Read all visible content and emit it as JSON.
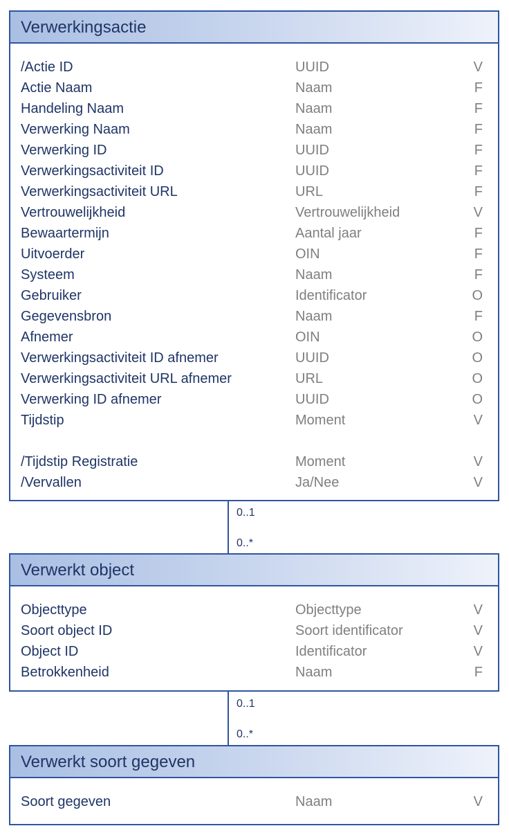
{
  "classes": [
    {
      "title": "Verwerkingsactie",
      "attributes": [
        {
          "name": "/Actie ID",
          "type": "UUID",
          "flag": "V"
        },
        {
          "name": "Actie Naam",
          "type": "Naam",
          "flag": "F"
        },
        {
          "name": "Handeling Naam",
          "type": "Naam",
          "flag": "F"
        },
        {
          "name": "Verwerking Naam",
          "type": "Naam",
          "flag": "F"
        },
        {
          "name": "Verwerking ID",
          "type": "UUID",
          "flag": "F"
        },
        {
          "name": "Verwerkingsactiviteit ID",
          "type": "UUID",
          "flag": "F"
        },
        {
          "name": "Verwerkingsactiviteit URL",
          "type": "URL",
          "flag": "F"
        },
        {
          "name": "Vertrouwelijkheid",
          "type": "Vertrouwelijkheid",
          "flag": "V"
        },
        {
          "name": "Bewaartermijn",
          "type": "Aantal jaar",
          "flag": "F"
        },
        {
          "name": "Uitvoerder",
          "type": "OIN",
          "flag": "F"
        },
        {
          "name": "Systeem",
          "type": "Naam",
          "flag": "F"
        },
        {
          "name": "Gebruiker",
          "type": "Identificator",
          "flag": "O"
        },
        {
          "name": "Gegevensbron",
          "type": "Naam",
          "flag": "F"
        },
        {
          "name": "Afnemer",
          "type": "OIN",
          "flag": "O"
        },
        {
          "name": "Verwerkingsactiviteit ID afnemer",
          "type": "UUID",
          "flag": "O"
        },
        {
          "name": "Verwerkingsactiviteit URL afnemer",
          "type": "URL",
          "flag": "O"
        },
        {
          "name": "Verwerking ID afnemer",
          "type": "UUID",
          "flag": "O"
        },
        {
          "name": "Tijdstip",
          "type": "Moment",
          "flag": "V"
        },
        {
          "name": "",
          "type": "",
          "flag": ""
        },
        {
          "name": "/Tijdstip Registratie",
          "type": "Moment",
          "flag": "V"
        },
        {
          "name": "/Vervallen",
          "type": "Ja/Nee",
          "flag": "V"
        }
      ]
    },
    {
      "title": "Verwerkt object",
      "attributes": [
        {
          "name": "Objecttype",
          "type": "Objecttype",
          "flag": "V"
        },
        {
          "name": "Soort object ID",
          "type": "Soort identificator",
          "flag": "V"
        },
        {
          "name": "Object ID",
          "type": "Identificator",
          "flag": "V"
        },
        {
          "name": "Betrokkenheid",
          "type": "Naam",
          "flag": "F"
        }
      ]
    },
    {
      "title": "Verwerkt soort gegeven",
      "attributes": [
        {
          "name": "Soort gegeven",
          "type": "Naam",
          "flag": "V"
        }
      ]
    }
  ],
  "associations": [
    {
      "upper": "0..1",
      "lower": "0..*"
    },
    {
      "upper": "0..1",
      "lower": "0..*"
    }
  ]
}
